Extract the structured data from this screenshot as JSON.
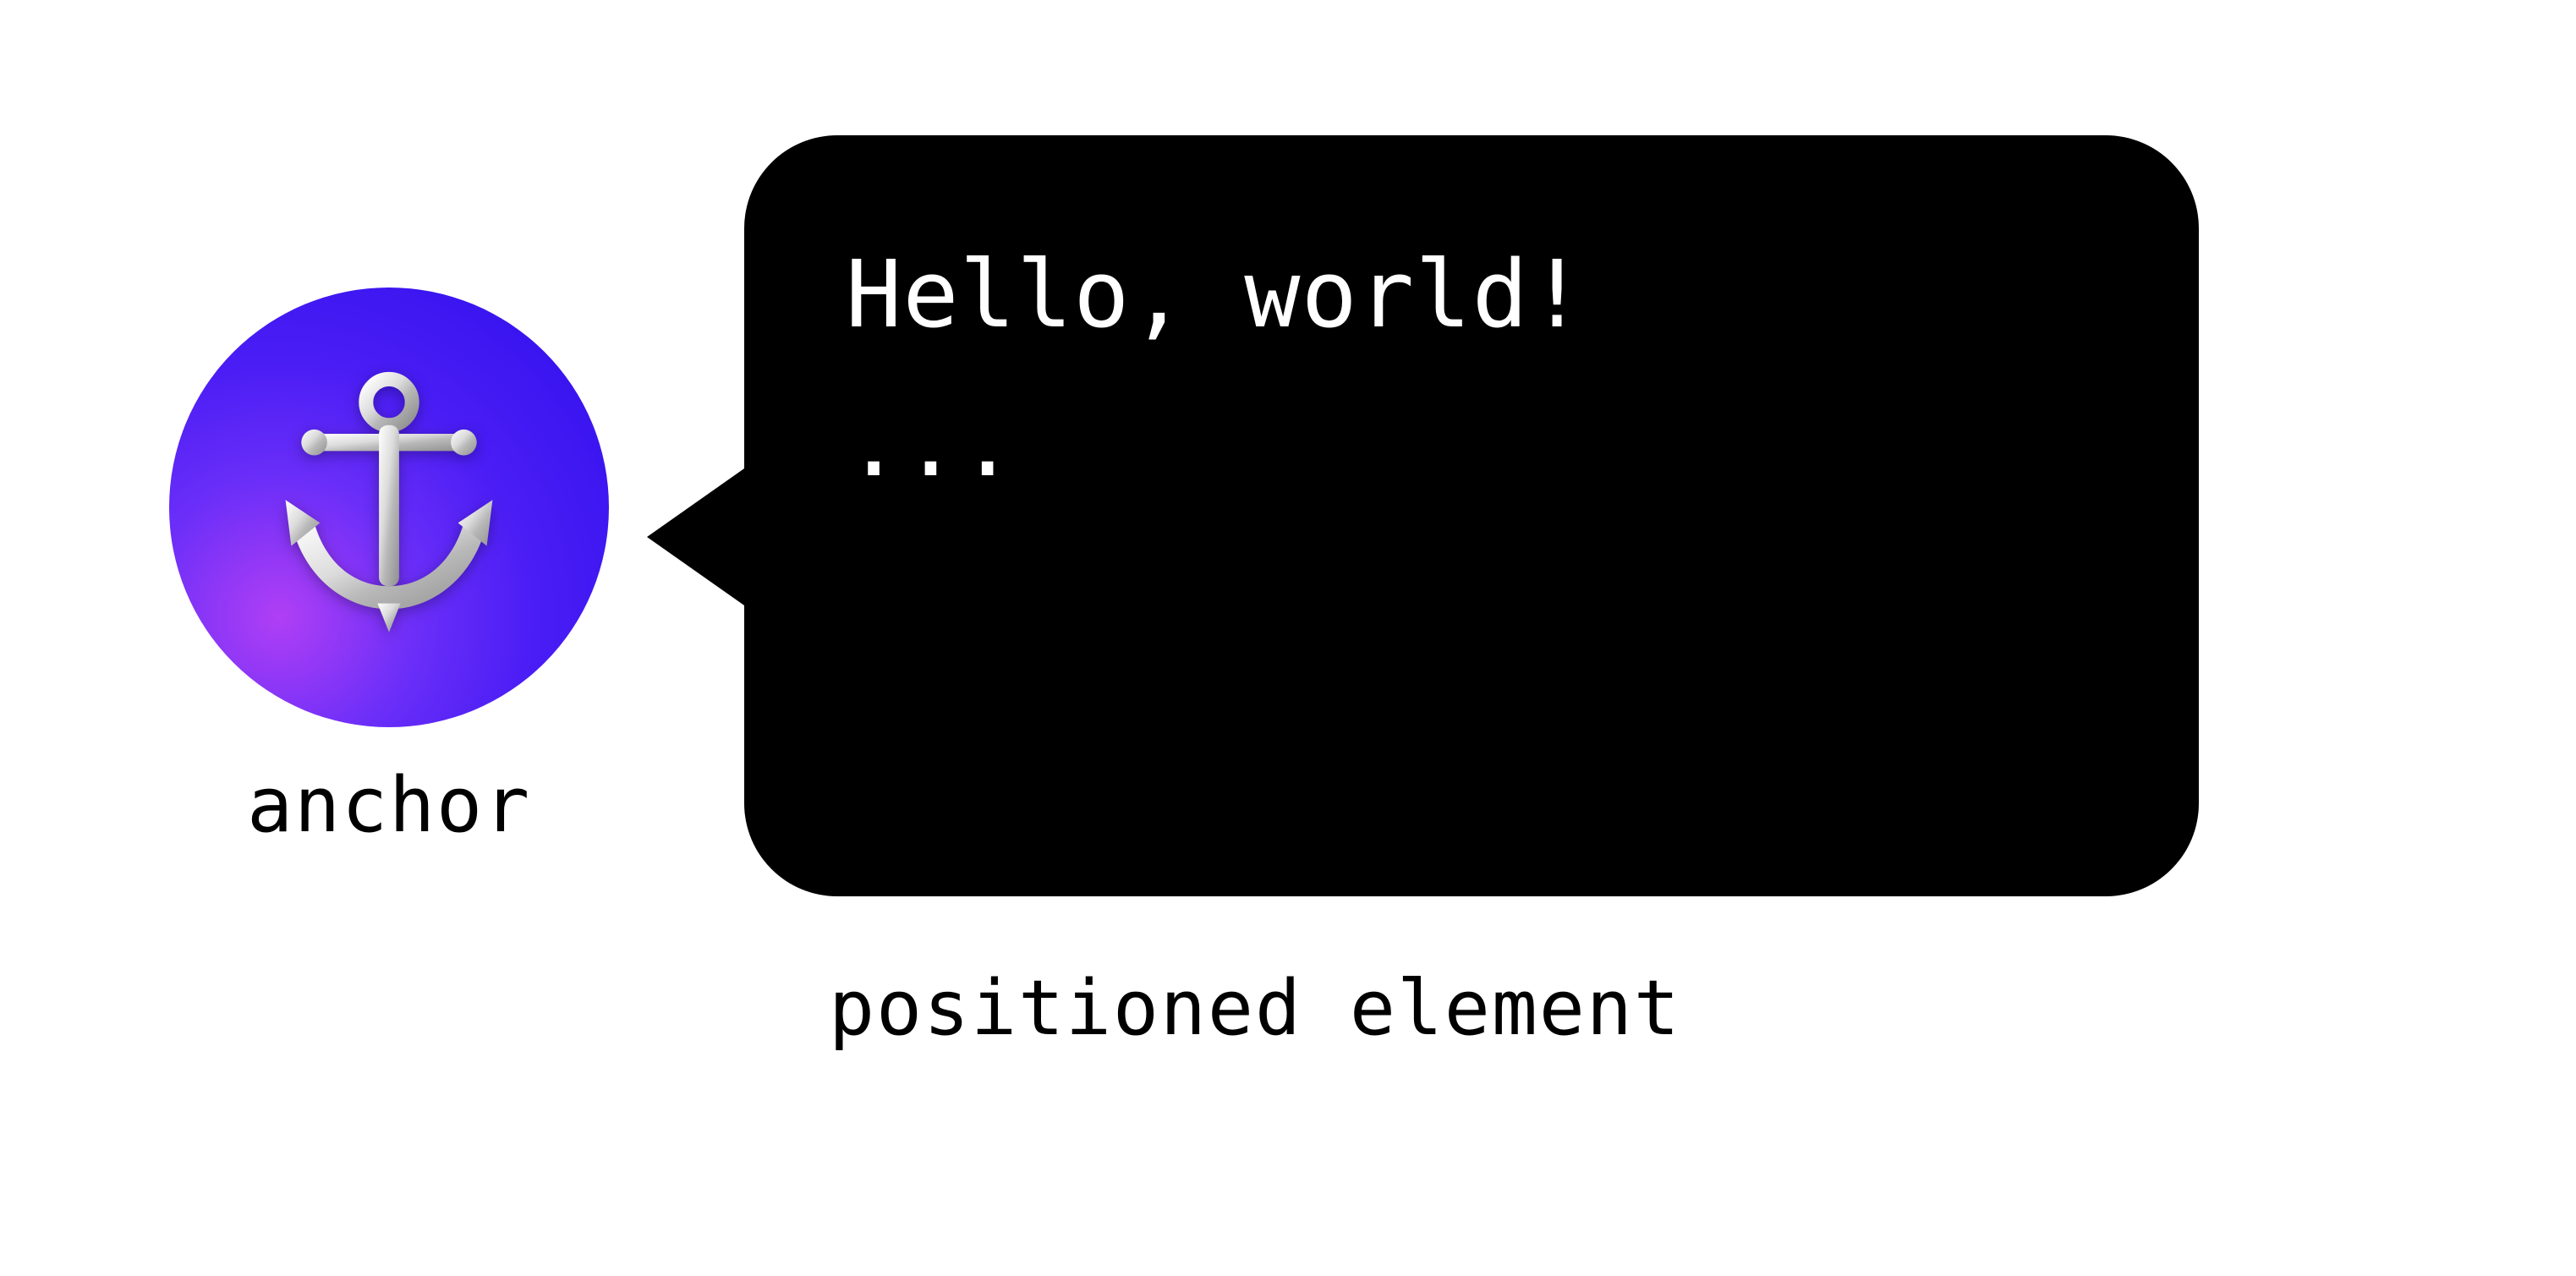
{
  "anchor": {
    "label": "anchor",
    "icon_name": "anchor-icon"
  },
  "bubble": {
    "line1": "Hello, world!",
    "line2": "..."
  },
  "positioned_label": "positioned element",
  "colors": {
    "bubble_bg": "#000000",
    "bubble_text": "#ffffff",
    "gradient_start": "#b03ff5",
    "gradient_end": "#2f0ee8"
  }
}
